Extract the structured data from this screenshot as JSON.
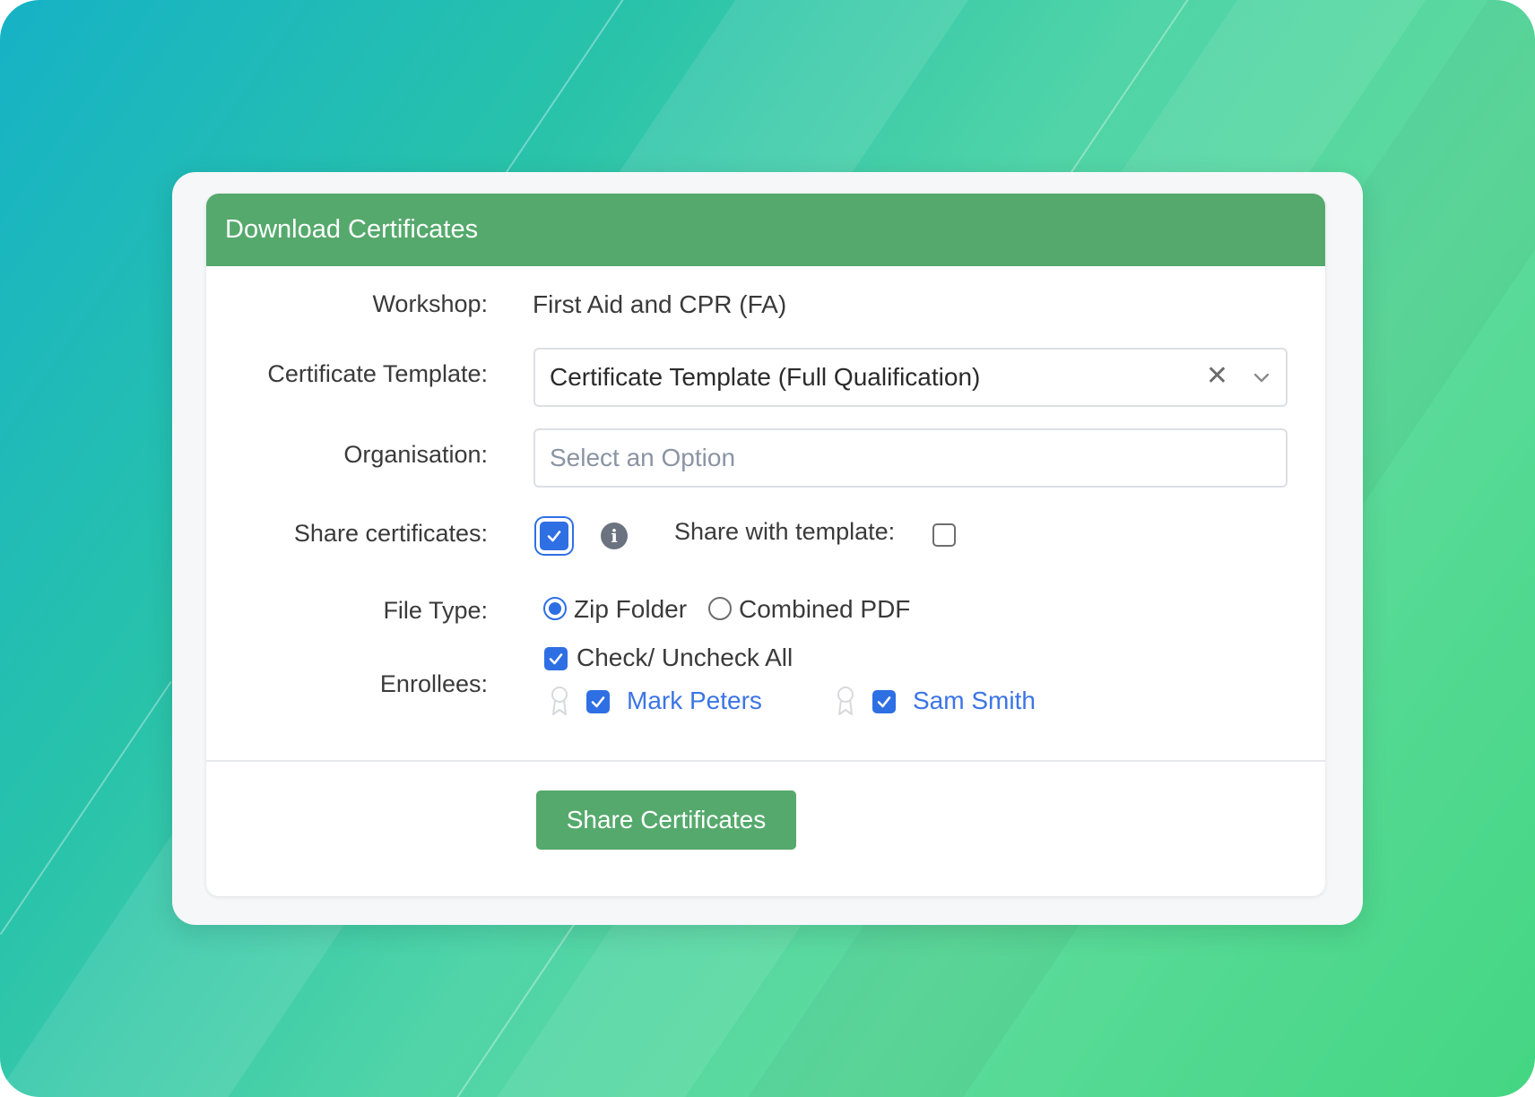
{
  "dialog": {
    "title": "Download Certificates",
    "workshop": {
      "label": "Workshop:",
      "value": "First Aid and CPR (FA)"
    },
    "template": {
      "label": "Certificate Template:",
      "value": "Certificate Template (Full Qualification)"
    },
    "organisation": {
      "label": "Organisation:",
      "placeholder": "Select an Option"
    },
    "share": {
      "label": "Share certificates:",
      "checked": true,
      "with_template_label": "Share with template:",
      "with_template_checked": false
    },
    "file_type": {
      "label": "File Type:",
      "options": [
        "Zip Folder",
        "Combined PDF"
      ],
      "selected": "Zip Folder"
    },
    "enrollees": {
      "label": "Enrollees:",
      "check_all_label": "Check/ Uncheck All",
      "people": [
        {
          "name": "Mark Peters",
          "checked": true
        },
        {
          "name": "Sam Smith",
          "checked": true
        }
      ]
    },
    "submit_label": "Share Certificates"
  },
  "colors": {
    "header": "#55a96c",
    "accent": "#2f6fe4",
    "link": "#3b74e6"
  }
}
